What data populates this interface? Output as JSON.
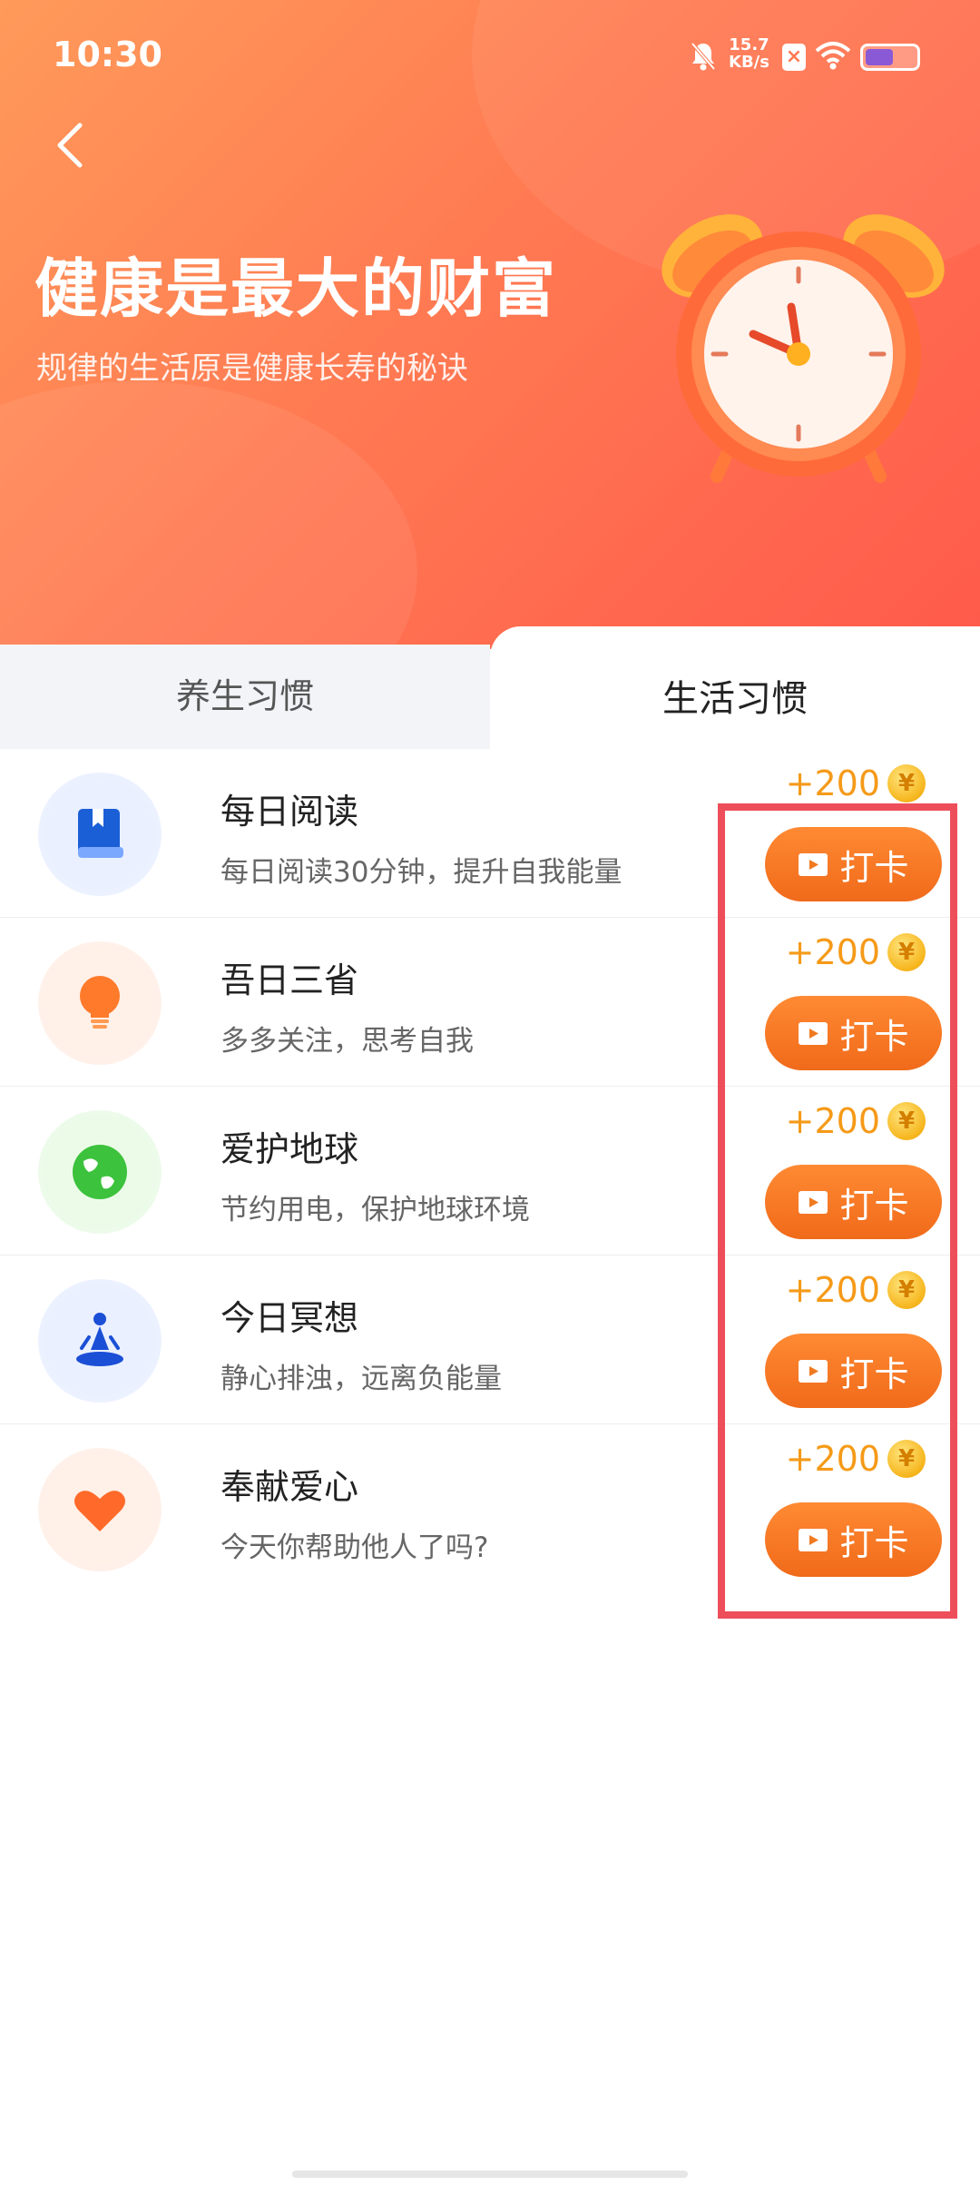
{
  "status_bar": {
    "time": "10:30",
    "net_speed_value": "15.7",
    "net_speed_unit": "KB/s",
    "battery_level": 0.55
  },
  "header": {
    "title": "健康是最大的财富",
    "subtitle": "规律的生活原是健康长寿的秘诀"
  },
  "tabs": [
    {
      "label": "养生习惯",
      "active": false
    },
    {
      "label": "生活习惯",
      "active": true
    }
  ],
  "habits": [
    {
      "name": "每日阅读",
      "desc": "每日阅读30分钟，提升自我能量",
      "reward": "+200",
      "button": "打卡",
      "icon": "book-icon"
    },
    {
      "name": "吾日三省",
      "desc": "多多关注，思考自我",
      "reward": "+200",
      "button": "打卡",
      "icon": "lightbulb-icon"
    },
    {
      "name": "爱护地球",
      "desc": "节约用电，保护地球环境",
      "reward": "+200",
      "button": "打卡",
      "icon": "globe-icon"
    },
    {
      "name": "今日冥想",
      "desc": "静心排浊，远离负能量",
      "reward": "+200",
      "button": "打卡",
      "icon": "meditation-icon"
    },
    {
      "name": "奉献爱心",
      "desc": "今天你帮助他人了吗?",
      "reward": "+200",
      "button": "打卡",
      "icon": "heart-icon"
    }
  ],
  "coin_symbol": "¥",
  "colors": {
    "accent": "#f06a1a",
    "reward": "#f59a18",
    "highlight": "#ee4e5a"
  }
}
